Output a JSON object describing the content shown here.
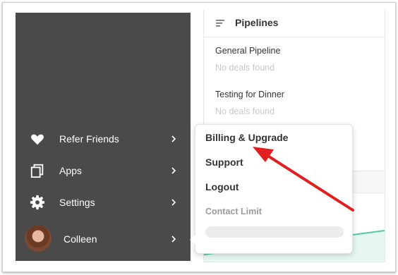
{
  "sidebar": {
    "items": [
      {
        "label": "Refer Friends",
        "icon": "heart-icon"
      },
      {
        "label": "Apps",
        "icon": "apps-icon"
      },
      {
        "label": "Settings",
        "icon": "gear-icon"
      }
    ],
    "user": {
      "name": "Colleen",
      "icon": "avatar"
    }
  },
  "pipelines": {
    "title": "Pipelines",
    "list": [
      {
        "name": "General Pipeline",
        "status": "No deals found"
      },
      {
        "name": "Testing for Dinner",
        "status": "No deals found"
      }
    ]
  },
  "dropdown": {
    "items": [
      "Billing & Upgrade",
      "Support",
      "Logout"
    ],
    "section_label": "Contact Limit"
  },
  "colors": {
    "sidebar_bg": "#4a4a4a",
    "chart_line": "#52c8a6",
    "annotation_arrow": "#e02020"
  }
}
